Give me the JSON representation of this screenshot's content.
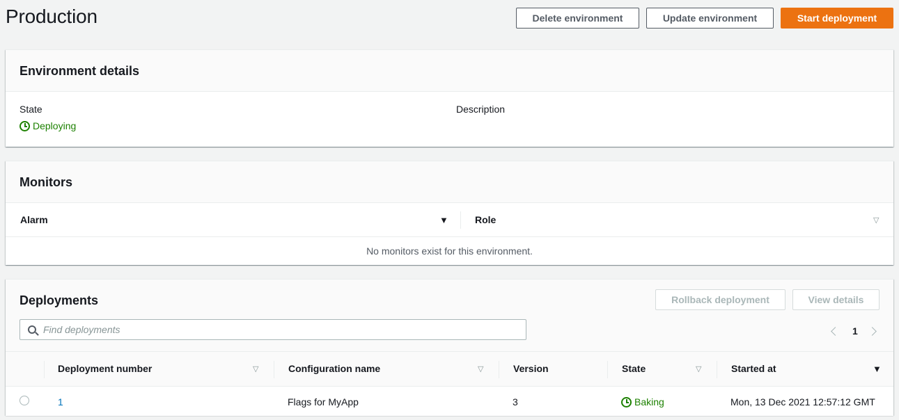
{
  "page": {
    "title": "Production",
    "buttons": {
      "delete": "Delete environment",
      "update": "Update environment",
      "start": "Start deployment"
    }
  },
  "environment_details": {
    "title": "Environment details",
    "state_label": "State",
    "state_value": "Deploying",
    "description_label": "Description"
  },
  "monitors": {
    "title": "Monitors",
    "columns": [
      "Alarm",
      "Role"
    ],
    "empty_text": "No monitors exist for this environment."
  },
  "deployments": {
    "title": "Deployments",
    "buttons": {
      "rollback": "Rollback deployment",
      "view_details": "View details"
    },
    "search_placeholder": "Find deployments",
    "page_number": "1",
    "columns": [
      "Deployment number",
      "Configuration name",
      "Version",
      "State",
      "Started at"
    ],
    "rows": [
      {
        "number": "1",
        "configuration": "Flags for MyApp",
        "version": "3",
        "state": "Baking",
        "started_at": "Mon, 13 Dec 2021 12:57:12 GMT"
      }
    ]
  },
  "colors": {
    "primary": "#ec7211",
    "success": "#1d8102",
    "link": "#0073bb",
    "background": "#f2f3f3"
  }
}
